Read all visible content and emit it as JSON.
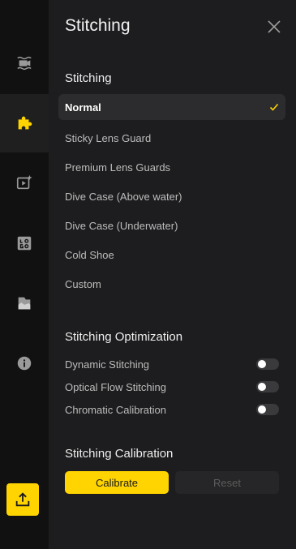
{
  "panel": {
    "title": "Stitching"
  },
  "stitching": {
    "heading": "Stitching",
    "items": [
      {
        "label": "Normal",
        "selected": true
      },
      {
        "label": "Sticky Lens Guard"
      },
      {
        "label": "Premium Lens Guards"
      },
      {
        "label": "Dive Case (Above water)"
      },
      {
        "label": "Dive Case (Underwater)"
      },
      {
        "label": "Cold Shoe"
      },
      {
        "label": "Custom"
      }
    ]
  },
  "optimization": {
    "heading": "Stitching Optimization",
    "options": [
      {
        "label": "Dynamic Stitching",
        "on": false
      },
      {
        "label": "Optical Flow Stitching",
        "on": false
      },
      {
        "label": "Chromatic Calibration",
        "on": false
      }
    ]
  },
  "calibration": {
    "heading": "Stitching Calibration",
    "calibrate_label": "Calibrate",
    "reset_label": "Reset"
  },
  "colors": {
    "accent": "#ffd400",
    "panel": "#1d1d1f",
    "rail": "#111111"
  },
  "rail_icons": [
    "stabilize-icon",
    "stitching-puzzle-icon",
    "video-effects-icon",
    "logo-icon",
    "folder-icon",
    "info-icon",
    "export-icon"
  ]
}
